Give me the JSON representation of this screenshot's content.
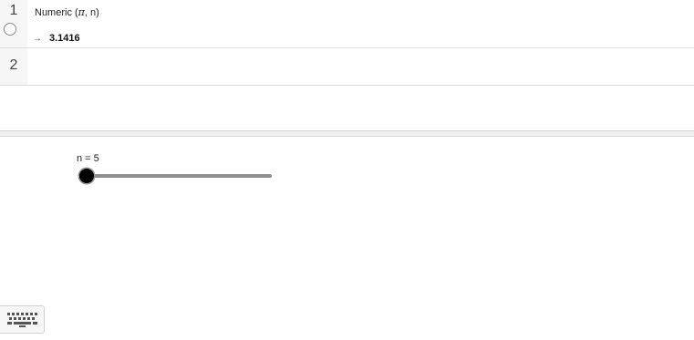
{
  "cas": {
    "rows": [
      {
        "number": "1",
        "input_prefix": "Numeric (",
        "input_pi": "π",
        "input_suffix": ", n)",
        "output_arrow": "→",
        "output_value": "3.1416"
      },
      {
        "number": "2"
      }
    ]
  },
  "graphics": {
    "slider": {
      "label": "n = 5",
      "variable": "n",
      "value": 5,
      "fraction": 0.0
    }
  },
  "icons": {
    "keyboard": "keyboard-icon",
    "radio": "row-visibility-toggle-icon"
  },
  "colors": {
    "slider_track": "#8f8f8f",
    "slider_handle": "#000000",
    "divider": "#dcdcdc"
  }
}
